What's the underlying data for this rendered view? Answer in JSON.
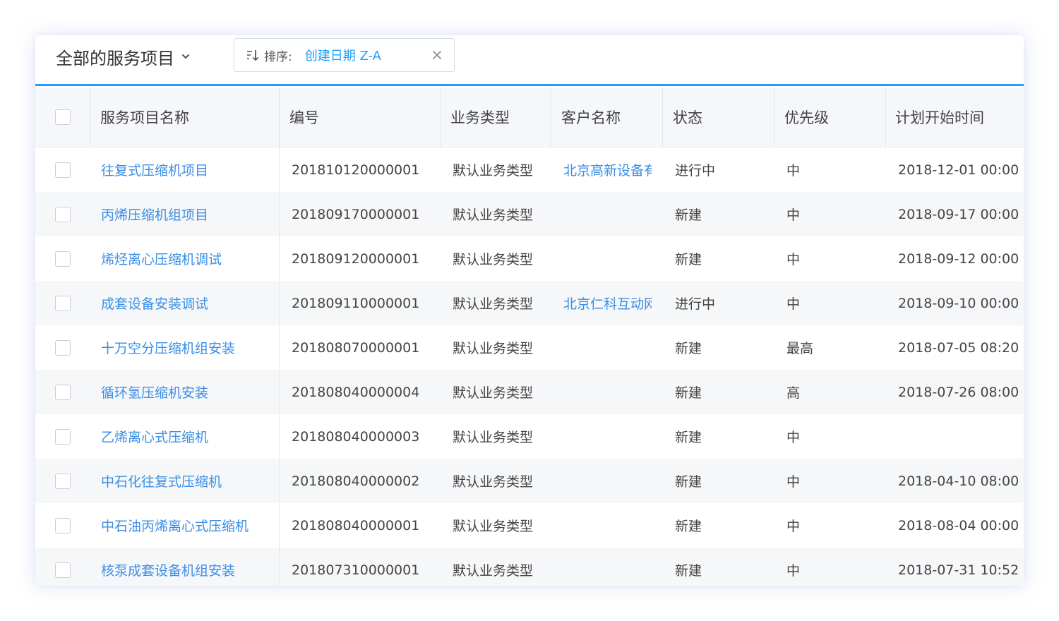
{
  "toolbar": {
    "view_title": "全部的服务项目",
    "sort_label": "排序:",
    "sort_value": "创建日期 Z-A"
  },
  "table": {
    "headers": {
      "name": "服务项目名称",
      "code": "编号",
      "type": "业务类型",
      "customer": "客户名称",
      "status": "状态",
      "priority": "优先级",
      "start_time": "计划开始时间"
    },
    "rows": [
      {
        "name": "往复式压缩机项目",
        "code": "201810120000001",
        "type": "默认业务类型",
        "customer": "北京高新设备有",
        "status": "进行中",
        "priority": "中",
        "start_time": "2018-12-01 00:00"
      },
      {
        "name": "丙烯压缩机组项目",
        "code": "201809170000001",
        "type": "默认业务类型",
        "customer": "",
        "status": "新建",
        "priority": "中",
        "start_time": "2018-09-17 00:00"
      },
      {
        "name": "烯烃离心压缩机调试",
        "code": "201809120000001",
        "type": "默认业务类型",
        "customer": "",
        "status": "新建",
        "priority": "中",
        "start_time": "2018-09-12 00:00"
      },
      {
        "name": "成套设备安装调试",
        "code": "201809110000001",
        "type": "默认业务类型",
        "customer": "北京仁科互动网",
        "status": "进行中",
        "priority": "中",
        "start_time": "2018-09-10 00:00"
      },
      {
        "name": "十万空分压缩机组安装",
        "code": "201808070000001",
        "type": "默认业务类型",
        "customer": "",
        "status": "新建",
        "priority": "最高",
        "start_time": "2018-07-05 08:20"
      },
      {
        "name": "循环氢压缩机安装",
        "code": "201808040000004",
        "type": "默认业务类型",
        "customer": "",
        "status": "新建",
        "priority": "高",
        "start_time": "2018-07-26 08:00"
      },
      {
        "name": "乙烯离心式压缩机",
        "code": "201808040000003",
        "type": "默认业务类型",
        "customer": "",
        "status": "新建",
        "priority": "中",
        "start_time": ""
      },
      {
        "name": "中石化往复式压缩机",
        "code": "201808040000002",
        "type": "默认业务类型",
        "customer": "",
        "status": "新建",
        "priority": "中",
        "start_time": "2018-04-10 08:00"
      },
      {
        "name": "中石油丙烯离心式压缩机",
        "code": "201808040000001",
        "type": "默认业务类型",
        "customer": "",
        "status": "新建",
        "priority": "中",
        "start_time": "2018-08-04 00:00"
      },
      {
        "name": "核泵成套设备机组安装",
        "code": "201807310000001",
        "type": "默认业务类型",
        "customer": "",
        "status": "新建",
        "priority": "中",
        "start_time": "2018-07-31 10:52"
      }
    ]
  },
  "colors": {
    "accent": "#1e9fff",
    "link": "#3a8ee6",
    "header_bg": "#f5f7fa",
    "alt_row_bg": "#f6f7f9"
  },
  "icons": {
    "view_dropdown": "chevron-down-icon",
    "sort": "sort-descending-icon",
    "clear": "close-icon"
  }
}
